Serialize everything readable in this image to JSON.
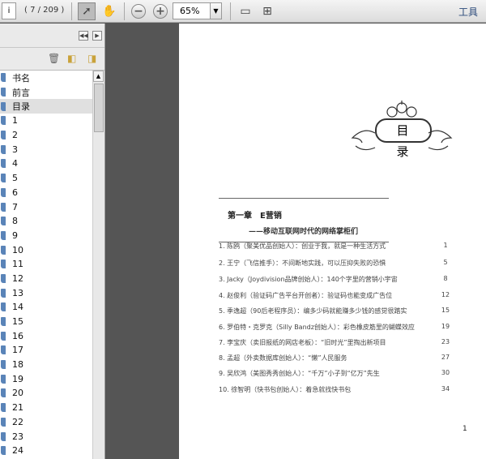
{
  "toolbar": {
    "page_input": "i",
    "page_count": "( 7 / 209 )",
    "zoom": "65%",
    "tools_label": "工具"
  },
  "bookmarks": [
    "书名",
    "前言",
    "目录",
    "1",
    "2",
    "3",
    "4",
    "5",
    "6",
    "7",
    "8",
    "9",
    "10",
    "11",
    "12",
    "13",
    "14",
    "15",
    "16",
    "17",
    "18",
    "19",
    "20",
    "21",
    "22",
    "23",
    "24"
  ],
  "selected_bookmark": "目录",
  "document": {
    "title": "目 录",
    "chapter": "第一章　E营销",
    "subtitle": "——移动互联网时代的网络掌柜们",
    "entries": [
      {
        "text": "1. 陈鸥（聚美优品创始人）：创业于我，就是一种生活方式",
        "page": "1"
      },
      {
        "text": "2. 王宁（飞信推手）：不间断地实践，可以压抑失败的恐惧",
        "page": "5"
      },
      {
        "text": "3. Jacky（Joydivision品牌创始人）：140个字里的营销小宇宙",
        "page": "8"
      },
      {
        "text": "4. 赵俊利（验证码广告平台开创者）：验证码也能变成广告位",
        "page": "12"
      },
      {
        "text": "5. 季逸超（90后老程序员）：编多少码就能赚多少钱的感觉很踏实",
        "page": "15"
      },
      {
        "text": "6. 罗伯特・克罗克（Silly Bandz创始人）：彩色橡皮筋里的蝴蝶效应",
        "page": "19"
      },
      {
        "text": "7. 李宝庆（卖旧报纸的网店老板）：“旧时光”里掏出新项目",
        "page": "23"
      },
      {
        "text": "8. 孟超（外卖数据库创始人）：“懒”人民服务",
        "page": "27"
      },
      {
        "text": "9. 吴欣鸿（美图秀秀创始人）：“千万”小子到“亿万”先生",
        "page": "30"
      },
      {
        "text": "10. 徐智明（快书包创始人）：着急就找快书包",
        "page": "34"
      }
    ],
    "page_number": "1"
  }
}
